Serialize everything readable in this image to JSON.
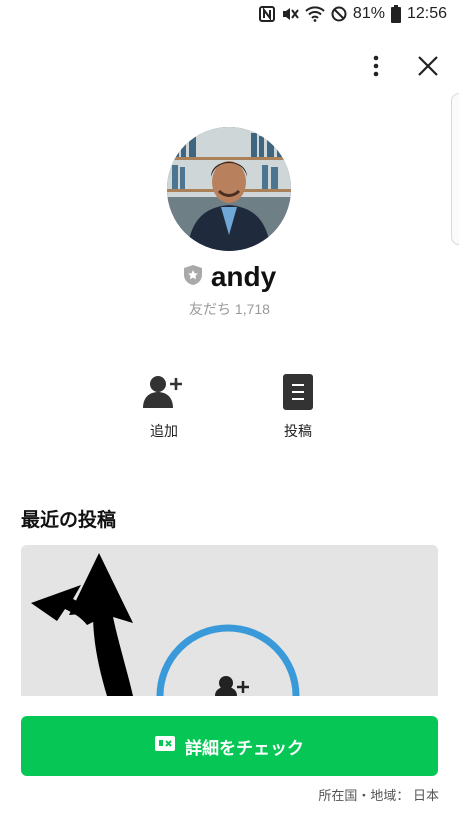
{
  "status_bar": {
    "battery": "81%",
    "time": "12:56",
    "icons": [
      "nfc-icon",
      "mute-icon",
      "wifi-icon",
      "do-not-disturb-icon",
      "battery-icon"
    ]
  },
  "header": {
    "icons": [
      "more-vertical-icon",
      "close-icon"
    ]
  },
  "profile": {
    "name": "andy",
    "friends": "友だち 1,718",
    "badge_icon": "official-shield-icon"
  },
  "actions": [
    {
      "label": "追加",
      "icon": "add-friend-icon"
    },
    {
      "label": "投稿",
      "icon": "posts-icon"
    }
  ],
  "recent_posts": {
    "title": "最近の投稿"
  },
  "cta": {
    "label": "詳細をチェック",
    "icon": "details-card-icon"
  },
  "region": {
    "text": "所在国・地域： 日本"
  },
  "colors": {
    "accent": "#06c755",
    "ring": "#3a9ad9"
  }
}
